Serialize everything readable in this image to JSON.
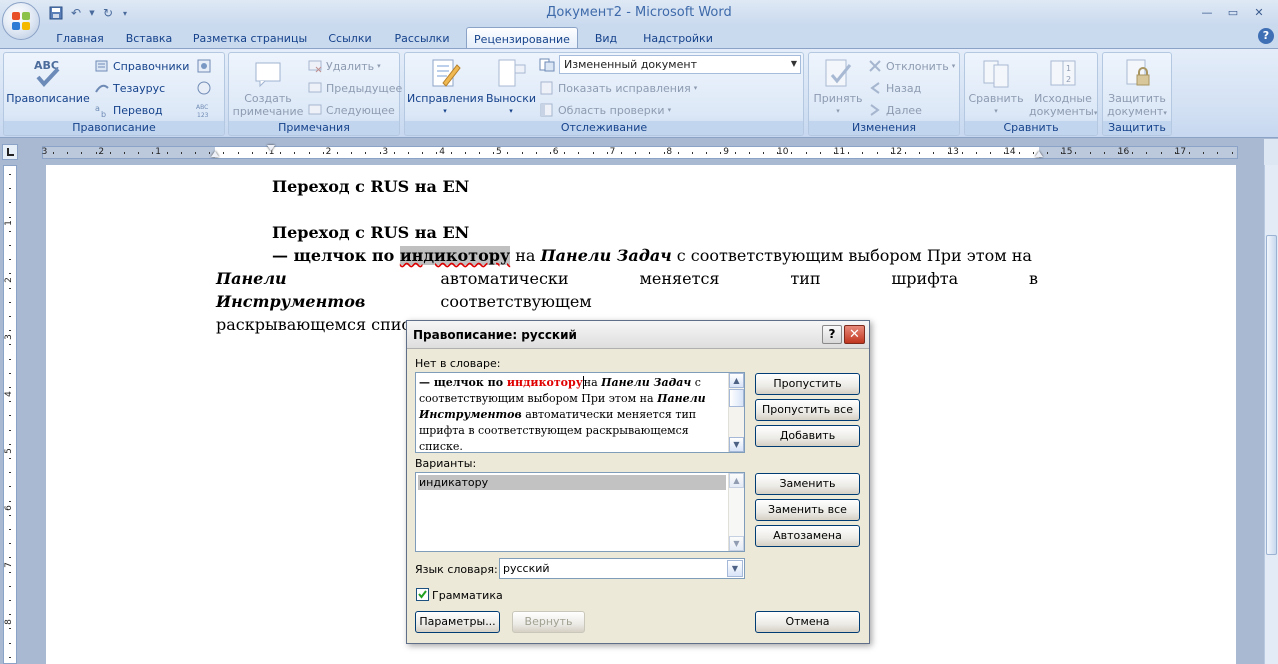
{
  "window": {
    "title": "Документ2 - Microsoft Word"
  },
  "tabs": [
    {
      "label": "Главная",
      "active": false
    },
    {
      "label": "Вставка",
      "active": false
    },
    {
      "label": "Разметка страницы",
      "active": false
    },
    {
      "label": "Ссылки",
      "active": false
    },
    {
      "label": "Рассылки",
      "active": false
    },
    {
      "label": "Рецензирование",
      "active": true
    },
    {
      "label": "Вид",
      "active": false
    },
    {
      "label": "Надстройки",
      "active": false
    }
  ],
  "ribbon": {
    "spelling": {
      "label": "Правописание",
      "spell_btn": "Правописание",
      "research": "Справочники",
      "thesaurus": "Тезаурус",
      "translate": "Перевод"
    },
    "comments": {
      "label": "Примечания",
      "new_comment_line1": "Создать",
      "new_comment_line2": "примечание",
      "delete": "Удалить",
      "previous": "Предыдущее",
      "next": "Следующее"
    },
    "tracking": {
      "label": "Отслеживание",
      "track_changes": "Исправления",
      "balloons": "Выноски",
      "display_mode": "Измененный документ",
      "show_markup": "Показать исправления",
      "reviewing_pane": "Область проверки"
    },
    "changes": {
      "label": "Изменения",
      "accept": "Принять",
      "reject": "Отклонить",
      "previous": "Назад",
      "next": "Далее"
    },
    "compare": {
      "label": "Сравнить",
      "compare": "Сравнить",
      "source_line1": "Исходные",
      "source_line2": "документы"
    },
    "protect": {
      "label": "Защитить",
      "protect_line1": "Защитить",
      "protect_line2": "документ"
    }
  },
  "ruler": {
    "labels_left": [
      "3",
      "2",
      "1"
    ],
    "labels_right": [
      "1",
      "2",
      "3",
      "4",
      "5",
      "6",
      "7",
      "8",
      "9",
      "10",
      "11",
      "12",
      "13",
      "14",
      "15",
      "16",
      "17"
    ],
    "vertical_labels": [
      "1",
      "2",
      "3",
      "4",
      "5",
      "6",
      "7",
      "8"
    ]
  },
  "document": {
    "heading1": "Переход с RUS на EN",
    "heading2": "Переход с RUS на EN",
    "p_dash": "— щелчок по ",
    "p_word": "индикотору",
    "p_on": " на ",
    "p_panel_tasks": "Панели Задач",
    "p_rest1": " с соответствующим выбором При этом на",
    "p_panel_tools": "Панели Инструментов",
    "p_rest2": " автоматически меняется тип шрифта в соответствующем",
    "p_rest3": "раскрывающемся списке."
  },
  "dialog": {
    "title": "Правописание: русский",
    "help_glyph": "?",
    "close_glyph": "✕",
    "not_in_dict_label": "Нет в словаре:",
    "nd_dash": "— щелчок по ",
    "nd_err": "индикотору",
    "nd_on": "на ",
    "nd_panel_tasks": "Панели Задач",
    "nd_rest1": " с соответствующим выбором При этом на ",
    "nd_panel_tools": "Панели Инструментов",
    "nd_rest2": " автоматически меняется тип шрифта в соответствующем раскрывающемся списке.",
    "suggestions_label": "Варианты:",
    "suggestions": [
      "индикатору"
    ],
    "dict_lang_label": "Язык словаря:",
    "dict_lang_value": "русский",
    "grammar_label": "Грамматика",
    "grammar_checked": true,
    "btn_ignore": "Пропустить",
    "btn_ignore_all": "Пропустить все",
    "btn_add": "Добавить",
    "btn_change": "Заменить",
    "btn_change_all": "Заменить все",
    "btn_autocorrect": "Автозамена",
    "btn_options": "Параметры...",
    "btn_undo": "Вернуть",
    "btn_cancel": "Отмена"
  }
}
